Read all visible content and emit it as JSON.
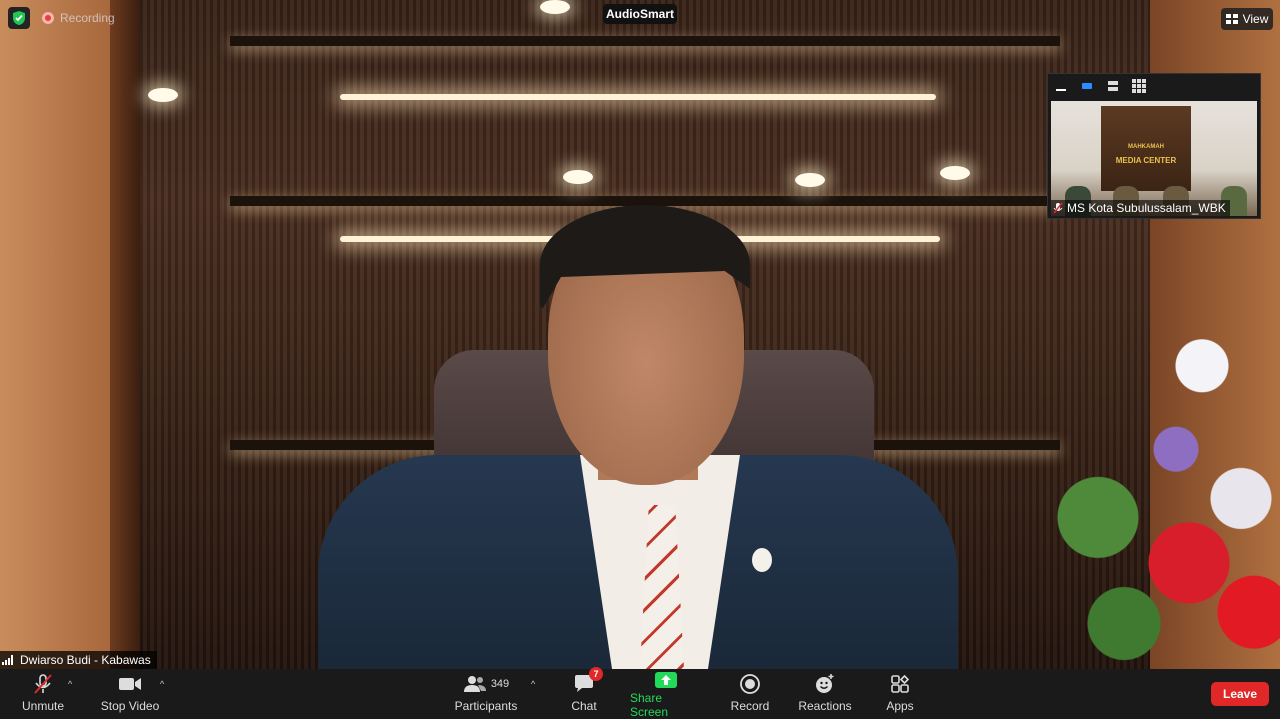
{
  "recording": {
    "label": "Recording"
  },
  "audio": {
    "label": "AudioSmart"
  },
  "view": {
    "label": "View"
  },
  "thumbnail": {
    "name": "MS Kota Subulussalam_WBK",
    "board_text_top": "MAHKAMAH",
    "board_text": "MEDIA CENTER"
  },
  "speaker": {
    "name": "Dwiarso Budi - Kabawas"
  },
  "toolbar": {
    "unmute": "Unmute",
    "stop_video": "Stop Video",
    "participants": "Participants",
    "participants_count": "349",
    "chat": "Chat",
    "chat_badge": "7",
    "share_screen": "Share Screen",
    "record": "Record",
    "reactions": "Reactions",
    "apps": "Apps",
    "leave": "Leave"
  },
  "colors": {
    "share_green": "#23d959",
    "leave_red": "#e02828",
    "toolbar_bg": "#1a1a1a"
  }
}
